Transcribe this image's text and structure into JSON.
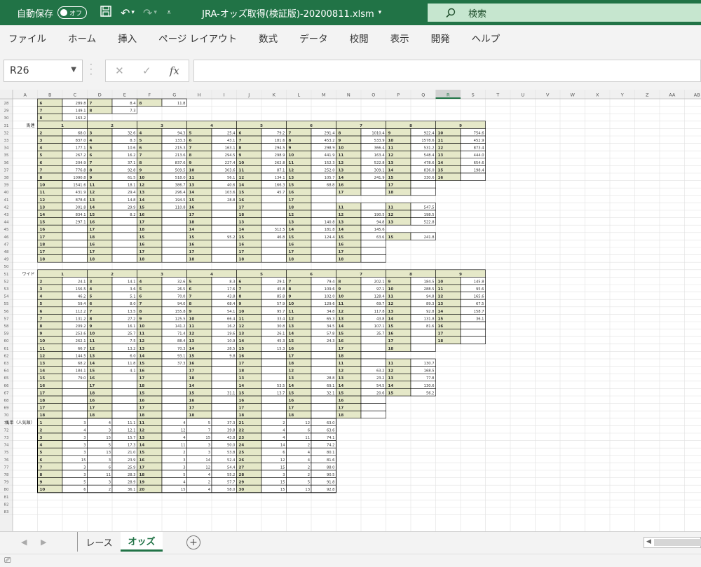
{
  "titlebar": {
    "autosave_label": "自動保存",
    "toggle_label": "オフ",
    "filename": "JRA-オッズ取得(検証版)-20200811.xlsm",
    "search_label": "検索"
  },
  "menu": [
    "ファイル",
    "ホーム",
    "挿入",
    "ページ レイアウト",
    "数式",
    "データ",
    "校閲",
    "表示",
    "開発",
    "ヘルプ"
  ],
  "formula": {
    "namebox": "R26",
    "fx": "fx",
    "value": ""
  },
  "sheet_tabs": [
    "レース",
    "オッズ"
  ],
  "active_sheet": "オッズ",
  "grid": {
    "columns": [
      "A",
      "B",
      "C",
      "D",
      "E",
      "F",
      "G",
      "H",
      "I",
      "J",
      "K",
      "L",
      "M",
      "N",
      "O",
      "P",
      "Q",
      "R",
      "S",
      "T",
      "U",
      "V",
      "W",
      "X",
      "Y",
      "Z",
      "AA",
      "AB",
      "AC"
    ],
    "selected_column": "R",
    "first_row": 28,
    "last_row": 83,
    "section_labels": {
      "31": "馬連",
      "51": "ワイド",
      "71": "馬単（人気順）"
    },
    "section_headers": [
      "1",
      "2",
      "3",
      "4",
      "5",
      "6",
      "7",
      "8",
      "9"
    ],
    "rows_28_30": [
      [
        "6",
        "289.8",
        "7",
        "8.4",
        "8",
        "11.8"
      ],
      [
        "7",
        "149.1",
        "8",
        "7.3"
      ],
      [
        "8",
        "163.2"
      ]
    ],
    "umaren": [
      [
        "2",
        "68.0",
        "3",
        "32.6",
        "4",
        "94.3",
        "5",
        "25.4",
        "6",
        "79.2",
        "7",
        "291.4",
        "8",
        "1010.4",
        "9",
        "922.4",
        "10",
        "754.6"
      ],
      [
        "3",
        "837.0",
        "4",
        "8.3",
        "5",
        "133.3",
        "6",
        "43.1",
        "7",
        "181.6",
        "8",
        "453.2",
        "9",
        "533.9",
        "10",
        "1578.6",
        "11",
        "452.9"
      ],
      [
        "4",
        "177.1",
        "5",
        "10.6",
        "6",
        "215.3",
        "7",
        "163.1",
        "8",
        "294.5",
        "9",
        "298.9",
        "10",
        "366.4",
        "11",
        "531.2",
        "12",
        "873.4"
      ],
      [
        "5",
        "267.2",
        "6",
        "16.2",
        "7",
        "213.6",
        "8",
        "294.5",
        "9",
        "298.9",
        "10",
        "441.9",
        "11",
        "163.4",
        "12",
        "548.4",
        "13",
        "444.0"
      ],
      [
        "6",
        "204.9",
        "7",
        "37.1",
        "8",
        "837.6",
        "9",
        "227.4",
        "10",
        "262.8",
        "11",
        "152.3",
        "12",
        "522.8",
        "13",
        "478.6",
        "14",
        "654.6"
      ],
      [
        "7",
        "776.8",
        "8",
        "92.8",
        "9",
        "509.5",
        "10",
        "303.6",
        "11",
        "87.1",
        "12",
        "252.0",
        "13",
        "309.1",
        "14",
        "836.0",
        "15",
        "198.4"
      ],
      [
        "8",
        "1090.8",
        "9",
        "61.5",
        "10",
        "518.0",
        "11",
        "56.1",
        "12",
        "134.1",
        "13",
        "105.7",
        "14",
        "241.9",
        "15",
        "330.6",
        "16",
        ""
      ],
      [
        "10",
        "1541.6",
        "11",
        "18.1",
        "12",
        "386.7",
        "13",
        "40.6",
        "14",
        "166.3",
        "15",
        "68.8",
        "16",
        "",
        "17",
        ""
      ],
      [
        "11",
        "431.9",
        "12",
        "29.4",
        "13",
        "296.4",
        "14",
        "103.6",
        "15",
        "45.7",
        "16",
        "",
        "17",
        "",
        "18",
        ""
      ],
      [
        "12",
        "878.6",
        "13",
        "14.8",
        "14",
        "194.5",
        "15",
        "28.8",
        "16",
        "",
        "17",
        ""
      ],
      [
        "13",
        "301.8",
        "14",
        "29.9",
        "15",
        "110.8",
        "16",
        "",
        "17",
        "",
        "18",
        "",
        "11",
        "",
        "11",
        "547.5"
      ],
      [
        "14",
        "834.1",
        "15",
        "8.2",
        "16",
        "",
        "17",
        "",
        "18",
        "",
        "12",
        "",
        "12",
        "190.5",
        "12",
        "198.5"
      ],
      [
        "15",
        "297.1",
        "16",
        "",
        "17",
        "",
        "18",
        "",
        "13",
        "",
        "13",
        "140.8",
        "13",
        "94.8",
        "13",
        "522.8"
      ],
      [
        "16",
        "",
        "17",
        "",
        "18",
        "",
        "14",
        "",
        "14",
        "312.5",
        "14",
        "181.8",
        "14",
        "145.6"
      ],
      [
        "17",
        "",
        "18",
        "",
        "15",
        "",
        "15",
        "95.2",
        "15",
        "46.8",
        "15",
        "124.4",
        "15",
        "63.6",
        "15",
        "241.8"
      ],
      [
        "18",
        "",
        "16",
        "",
        "16",
        "",
        "16",
        "",
        "16",
        "",
        "16",
        "",
        "16",
        ""
      ],
      [
        "17",
        "",
        "17",
        "",
        "17",
        "",
        "17",
        "",
        "17",
        "",
        "17",
        "",
        "17",
        ""
      ],
      [
        "18",
        "",
        "18",
        "",
        "18",
        "",
        "18",
        "",
        "18",
        "",
        "18",
        "",
        "18",
        ""
      ]
    ],
    "wide": [
      [
        "2",
        "24.1",
        "3",
        "14.1",
        "4",
        "32.6",
        "5",
        "8.3",
        "6",
        "29.1",
        "7",
        "79.4",
        "8",
        "202.1",
        "9",
        "184.5",
        "10",
        "145.8"
      ],
      [
        "3",
        "156.5",
        "4",
        "3.6",
        "5",
        "26.5",
        "6",
        "17.6",
        "7",
        "45.8",
        "8",
        "109.6",
        "9",
        "97.1",
        "10",
        "288.5",
        "11",
        "95.6"
      ],
      [
        "4",
        "46.2",
        "5",
        "5.1",
        "6",
        "70.0",
        "7",
        "43.8",
        "8",
        "85.8",
        "9",
        "102.0",
        "10",
        "128.4",
        "11",
        "94.8",
        "12",
        "165.6"
      ],
      [
        "5",
        "59.4",
        "6",
        "8.0",
        "7",
        "94.0",
        "8",
        "68.4",
        "9",
        "57.9",
        "10",
        "129.6",
        "11",
        "69.7",
        "12",
        "89.3",
        "13",
        "67.5"
      ],
      [
        "6",
        "112.2",
        "7",
        "13.5",
        "8",
        "155.8",
        "9",
        "54.1",
        "10",
        "95.7",
        "11",
        "34.8",
        "12",
        "117.8",
        "13",
        "92.8",
        "14",
        "158.7"
      ],
      [
        "7",
        "131.2",
        "8",
        "27.2",
        "9",
        "125.5",
        "10",
        "66.4",
        "11",
        "33.4",
        "12",
        "65.3",
        "13",
        "43.8",
        "14",
        "131.8",
        "15",
        "36.1"
      ],
      [
        "8",
        "209.2",
        "9",
        "16.1",
        "10",
        "141.2",
        "11",
        "16.2",
        "12",
        "30.8",
        "13",
        "34.5",
        "14",
        "107.1",
        "15",
        "81.6",
        "16",
        ""
      ],
      [
        "9",
        "253.6",
        "10",
        "25.7",
        "11",
        "71.4",
        "12",
        "19.6",
        "13",
        "26.1",
        "14",
        "57.8",
        "15",
        "35.7",
        "16",
        "",
        "17",
        ""
      ],
      [
        "10",
        "262.1",
        "11",
        "7.5",
        "12",
        "88.4",
        "13",
        "10.9",
        "14",
        "45.3",
        "15",
        "24.3",
        "16",
        "",
        "17",
        "",
        "18",
        ""
      ],
      [
        "11",
        "66.7",
        "12",
        "13.2",
        "13",
        "70.3",
        "14",
        "28.5",
        "15",
        "15.3",
        "16",
        "",
        "17",
        "",
        "18",
        ""
      ],
      [
        "12",
        "144.5",
        "13",
        "6.0",
        "14",
        "93.1",
        "15",
        "9.8",
        "16",
        "",
        "17",
        "",
        "18",
        ""
      ],
      [
        "13",
        "68.2",
        "14",
        "11.8",
        "15",
        "37.3",
        "16",
        "",
        "17",
        "",
        "18",
        "",
        "11",
        "",
        "11",
        "130.7"
      ],
      [
        "14",
        "184.1",
        "15",
        "4.1",
        "16",
        "",
        "17",
        "",
        "18",
        "",
        "12",
        "",
        "12",
        "63.2",
        "12",
        "168.5"
      ],
      [
        "15",
        "79.0",
        "16",
        "",
        "17",
        "",
        "18",
        "",
        "13",
        "",
        "13",
        "28.8",
        "13",
        "23.2",
        "13",
        "77.8"
      ],
      [
        "16",
        "",
        "17",
        "",
        "18",
        "",
        "14",
        "",
        "14",
        "53.5",
        "14",
        "69.1",
        "14",
        "54.5",
        "14",
        "130.6"
      ],
      [
        "17",
        "",
        "18",
        "",
        "15",
        "",
        "15",
        "31.1",
        "15",
        "13.7",
        "15",
        "32.1",
        "15",
        "20.6",
        "15",
        "56.2"
      ],
      [
        "18",
        "",
        "16",
        "",
        "16",
        "",
        "16",
        "",
        "16",
        "",
        "16",
        "",
        "16",
        ""
      ],
      [
        "17",
        "",
        "17",
        "",
        "17",
        "",
        "17",
        "",
        "17",
        "",
        "17",
        "",
        "17",
        ""
      ],
      [
        "18",
        "",
        "18",
        "",
        "18",
        "",
        "18",
        "",
        "18",
        "",
        "18",
        "",
        "18",
        ""
      ]
    ],
    "umatan": [
      [
        "1",
        "3",
        "4",
        "11.1",
        "11",
        "4",
        "5",
        "37.3",
        "21",
        "2",
        "12",
        "63.0"
      ],
      [
        "2",
        "4",
        "3",
        "12.1",
        "12",
        "12",
        "7",
        "39.8",
        "22",
        "4",
        "6",
        "63.6"
      ],
      [
        "3",
        "3",
        "15",
        "15.7",
        "13",
        "4",
        "15",
        "43.8",
        "23",
        "4",
        "11",
        "74.1"
      ],
      [
        "4",
        "3",
        "5",
        "17.3",
        "14",
        "11",
        "3",
        "50.0",
        "24",
        "14",
        "2",
        "74.2"
      ],
      [
        "5",
        "3",
        "13",
        "21.0",
        "15",
        "2",
        "3",
        "53.8",
        "25",
        "6",
        "4",
        "80.1"
      ],
      [
        "6",
        "15",
        "3",
        "23.9",
        "16",
        "3",
        "14",
        "52.4",
        "26",
        "12",
        "4",
        "81.6"
      ],
      [
        "7",
        "3",
        "6",
        "25.9",
        "17",
        "3",
        "12",
        "54.4",
        "27",
        "15",
        "2",
        "88.0"
      ],
      [
        "8",
        "3",
        "11",
        "28.3",
        "18",
        "5",
        "4",
        "55.2",
        "28",
        "3",
        "2",
        "90.5"
      ],
      [
        "9",
        "5",
        "3",
        "28.9",
        "19",
        "4",
        "2",
        "57.7",
        "29",
        "15",
        "5",
        "91.8"
      ],
      [
        "10",
        "6",
        "2",
        "36.1",
        "20",
        "15",
        "4",
        "58.0",
        "30",
        "15",
        "13",
        "92.8"
      ]
    ]
  }
}
